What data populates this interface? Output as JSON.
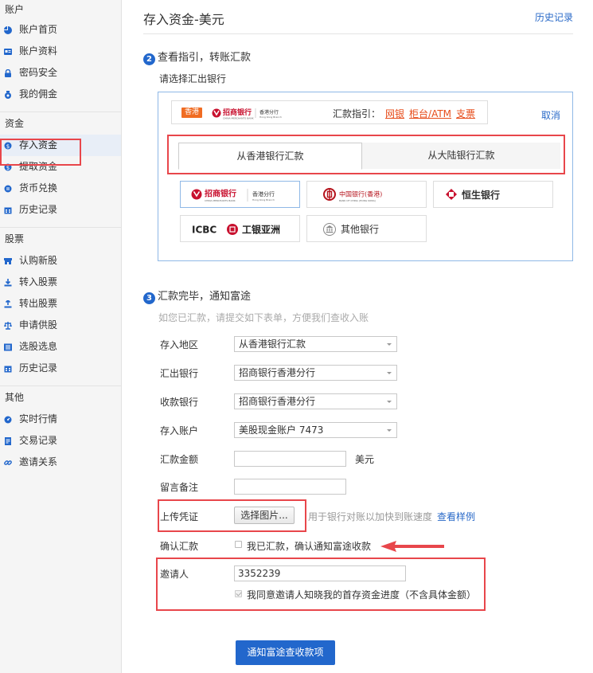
{
  "sidebar": {
    "sections": [
      {
        "title": "账户",
        "items": [
          {
            "label": "账户首页",
            "icon": "pie-chart-icon"
          },
          {
            "label": "账户资料",
            "icon": "id-card-icon"
          },
          {
            "label": "密码安全",
            "icon": "lock-icon"
          },
          {
            "label": "我的佣金",
            "icon": "coin-icon"
          }
        ]
      },
      {
        "title": "资金",
        "items": [
          {
            "label": "存入资金",
            "icon": "deposit-icon",
            "active": true
          },
          {
            "label": "提取资金",
            "icon": "withdraw-icon"
          },
          {
            "label": "货币兑换",
            "icon": "exchange-icon"
          },
          {
            "label": "历史记录",
            "icon": "calendar-icon"
          }
        ]
      },
      {
        "title": "股票",
        "items": [
          {
            "label": "认购新股",
            "icon": "store-icon"
          },
          {
            "label": "转入股票",
            "icon": "download-icon"
          },
          {
            "label": "转出股票",
            "icon": "upload-icon"
          },
          {
            "label": "申请供股",
            "icon": "balance-icon"
          },
          {
            "label": "选股选息",
            "icon": "list-icon"
          },
          {
            "label": "历史记录",
            "icon": "calendar-icon"
          }
        ]
      },
      {
        "title": "其他",
        "items": [
          {
            "label": "实时行情",
            "icon": "gauge-icon"
          },
          {
            "label": "交易记录",
            "icon": "document-icon"
          },
          {
            "label": "邀请关系",
            "icon": "link-icon"
          }
        ]
      }
    ]
  },
  "header": {
    "title": "存入资金-美元",
    "history_link": "历史记录"
  },
  "step2": {
    "num": "2",
    "title": "查看指引，转账汇款",
    "select_label": "请选择汇出银行",
    "selected_bank": {
      "region_badge": "香港",
      "bank_name_cn": "招商银行",
      "bank_name_en": "CHINA MERCHANTS BANK",
      "branch_cn": "香港分行",
      "branch_en": "Hong Kong Branch",
      "guide_label": "汇款指引：",
      "guide_links": [
        "网银",
        "柜台/ATM",
        "支票"
      ]
    },
    "cancel": "取消",
    "tabs": [
      "从香港银行汇款",
      "从大陆银行汇款"
    ],
    "banks": [
      {
        "name": "招商银行",
        "sub": "香港分行",
        "en": "CHINA MERCHANTS BANK",
        "sub_en": "Hong Kong Branch"
      },
      {
        "name": "中国银行(香港)",
        "en": "BANK OF CHINA (HONG KONG)"
      },
      {
        "name": "恒生银行"
      },
      {
        "name": "ICBC",
        "name2": "工银亚洲"
      },
      {
        "name": "其他银行"
      }
    ]
  },
  "step3": {
    "num": "3",
    "title": "汇款完毕，通知富途",
    "hint": "如您已汇款，请提交如下表单，方便我们查收入账",
    "fields": {
      "region": {
        "label": "存入地区",
        "value": "从香港银行汇款"
      },
      "out_bank": {
        "label": "汇出银行",
        "value": "招商银行香港分行"
      },
      "in_bank": {
        "label": "收款银行",
        "value": "招商银行香港分行"
      },
      "account": {
        "label": "存入账户",
        "value": "美股现金账户 7473"
      },
      "amount": {
        "label": "汇款金额",
        "value": "",
        "unit": "美元"
      },
      "note": {
        "label": "留言备注",
        "value": ""
      },
      "voucher": {
        "label": "上传凭证",
        "button": "选择图片...",
        "hint": "用于银行对账以加快到账速度",
        "sample_link": "查看样例"
      },
      "confirm": {
        "label": "确认汇款",
        "checkbox": "我已汇款，确认通知富途收款",
        "checked": false
      },
      "inviter": {
        "label": "邀请人",
        "value": "3352239",
        "checkbox": "我同意邀请人知晓我的首存资金进度（不含具体金额）",
        "checked": true
      }
    },
    "submit": "通知富途查收款项"
  },
  "colors": {
    "primary": "#2267cc",
    "link": "#2a6ac8",
    "highlight_red": "#e8464b",
    "guide_link": "#e74c1a",
    "hk_badge": "#f06c22"
  }
}
